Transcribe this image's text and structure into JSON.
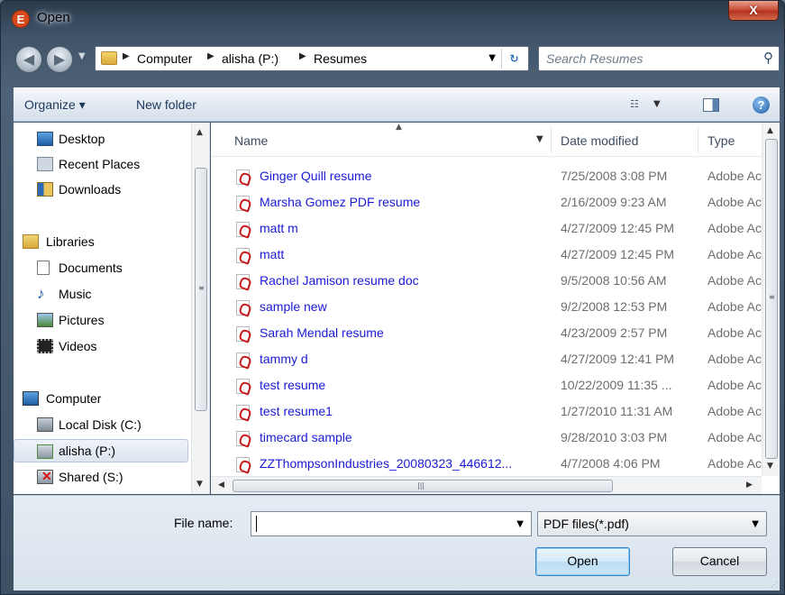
{
  "window": {
    "title": "Open",
    "app_icon_letter": "E",
    "close_glyph": "X"
  },
  "navigation": {
    "back_glyph": "◀",
    "forward_glyph": "▶",
    "breadcrumbs": [
      "Computer",
      "alisha (P:)",
      "Resumes"
    ],
    "search_placeholder": "Search Resumes"
  },
  "toolbar": {
    "organize_label": "Organize ▾",
    "new_folder_label": "New folder"
  },
  "nav_pane": {
    "items": [
      {
        "label": "Desktop",
        "icon": "desktop-icon"
      },
      {
        "label": "Recent Places",
        "icon": "recent-places-icon"
      },
      {
        "label": "Downloads",
        "icon": "downloads-icon"
      },
      {
        "label": "Libraries",
        "icon": "libraries-icon"
      },
      {
        "label": "Documents",
        "icon": "documents-icon"
      },
      {
        "label": "Music",
        "icon": "music-icon"
      },
      {
        "label": "Pictures",
        "icon": "pictures-icon"
      },
      {
        "label": "Videos",
        "icon": "videos-icon"
      },
      {
        "label": "Computer",
        "icon": "computer-icon"
      },
      {
        "label": "Local Disk (C:)",
        "icon": "local-disk-icon"
      },
      {
        "label": "alisha (P:)",
        "icon": "network-drive-icon",
        "selected": true
      },
      {
        "label": "Shared (S:)",
        "icon": "disconnected-drive-icon"
      }
    ]
  },
  "file_list": {
    "columns": [
      "Name",
      "Date modified",
      "Type"
    ],
    "files": [
      {
        "name": "Ginger Quill resume",
        "date": "7/25/2008 3:08 PM",
        "type": "Adobe Acrobat Document"
      },
      {
        "name": "Marsha Gomez PDF resume",
        "date": "2/16/2009 9:23 AM",
        "type": "Adobe Acrobat Document"
      },
      {
        "name": "matt m",
        "date": "4/27/2009 12:45 PM",
        "type": "Adobe Acrobat Document"
      },
      {
        "name": "matt",
        "date": "4/27/2009 12:45 PM",
        "type": "Adobe Acrobat Document"
      },
      {
        "name": "Rachel Jamison resume doc",
        "date": "9/5/2008 10:56 AM",
        "type": "Adobe Acrobat Document"
      },
      {
        "name": "sample new",
        "date": "9/2/2008 12:53 PM",
        "type": "Adobe Acrobat Document"
      },
      {
        "name": "Sarah Mendal resume",
        "date": "4/23/2009 2:57 PM",
        "type": "Adobe Acrobat Document"
      },
      {
        "name": "tammy d",
        "date": "4/27/2009 12:41 PM",
        "type": "Adobe Acrobat Document"
      },
      {
        "name": "test resume",
        "date": "10/22/2009 11:35 ...",
        "type": "Adobe Acrobat Document"
      },
      {
        "name": "test resume1",
        "date": "1/27/2010 11:31 AM",
        "type": "Adobe Acrobat Document"
      },
      {
        "name": "timecard sample",
        "date": "9/28/2010 3:03 PM",
        "type": "Adobe Acrobat Document"
      },
      {
        "name": "ZZThompsonIndustries_20080323_446612...",
        "date": "4/7/2008 4:06 PM",
        "type": "Adobe Acrobat Document"
      }
    ]
  },
  "bottom": {
    "file_name_label": "File name:",
    "file_name_value": "",
    "filter_value": "PDF files(*.pdf)",
    "open_label": "Open",
    "cancel_label": "Cancel"
  },
  "colors": {
    "link_blue": "#1a1ad6",
    "title_glass": "#415469",
    "close_red": "#c9523a"
  }
}
